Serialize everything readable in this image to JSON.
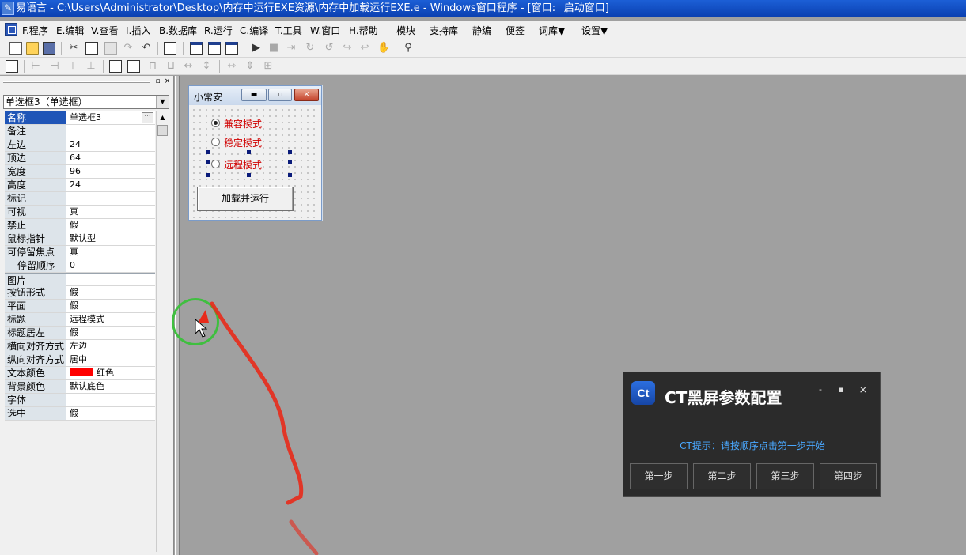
{
  "window": {
    "title": "易语言 - C:\\Users\\Administrator\\Desktop\\内存中运行EXE资源\\内存中加载运行EXE.e - Windows窗口程序 - [窗口: _启动窗口]"
  },
  "menu": {
    "items": [
      "F.程序",
      "E.编辑",
      "V.查看",
      "I.插入",
      "B.数据库",
      "R.运行",
      "C.编译",
      "T.工具",
      "W.窗口",
      "H.帮助",
      "模块",
      "支持库",
      "静编",
      "便签",
      "词库▼",
      "设置▼"
    ]
  },
  "panel": {
    "selector_value": "单选框3（单选框）",
    "selected_property": "名称",
    "properties": [
      {
        "key": "名称",
        "value": "单选框3"
      },
      {
        "key": "备注",
        "value": ""
      },
      {
        "key": "左边",
        "value": "24"
      },
      {
        "key": "顶边",
        "value": "64"
      },
      {
        "key": "宽度",
        "value": "96"
      },
      {
        "key": "高度",
        "value": "24"
      },
      {
        "key": "标记",
        "value": ""
      },
      {
        "key": "可视",
        "value": "真"
      },
      {
        "key": "禁止",
        "value": "假"
      },
      {
        "key": "鼠标指针",
        "value": "默认型"
      },
      {
        "key": "可停留焦点",
        "value": "真"
      },
      {
        "key": "停留顺序",
        "value": "0"
      },
      {
        "key": "图片",
        "value": ""
      },
      {
        "key": "按钮形式",
        "value": "假"
      },
      {
        "key": "平面",
        "value": "假"
      },
      {
        "key": "标题",
        "value": "远程模式"
      },
      {
        "key": "标题居左",
        "value": "假"
      },
      {
        "key": "横向对齐方式",
        "value": "左边"
      },
      {
        "key": "纵向对齐方式",
        "value": "居中"
      },
      {
        "key": "文本颜色",
        "value": "红色"
      },
      {
        "key": "背景颜色",
        "value": "默认底色"
      },
      {
        "key": "字体",
        "value": ""
      },
      {
        "key": "选中",
        "value": "假"
      }
    ]
  },
  "form": {
    "title": "小常安",
    "radios": [
      {
        "label": "兼容模式",
        "checked": true
      },
      {
        "label": "稳定模式",
        "checked": false
      },
      {
        "label": "远程模式",
        "checked": false
      }
    ],
    "button_label": "加载并运行"
  },
  "ct_popup": {
    "logo": "Ct",
    "title": "CT黑屏参数配置",
    "minimize": "-",
    "maximize": "▪",
    "close": "×",
    "tip": "CT提示：请按顺序点击第一步开始",
    "steps": [
      "第一步",
      "第二步",
      "第三步",
      "第四步"
    ]
  },
  "colors": {
    "radio_text": "#d00000",
    "text_color_swatch": "#ff0000",
    "popup_bg": "#2b2b2b",
    "tip": "#4aa8ff",
    "annotation_ring": "#3fbf3f",
    "annotation_stroke": "#e82a1a"
  }
}
